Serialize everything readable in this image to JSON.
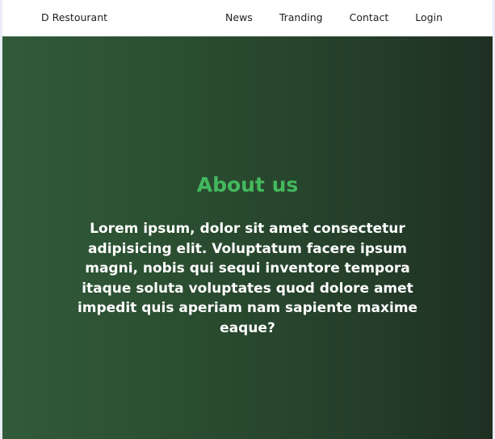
{
  "nav": {
    "brand": "D Restourant",
    "links": [
      "News",
      "Tranding",
      "Contact",
      "Login"
    ]
  },
  "hero": {
    "title": "About us",
    "text": "Lorem ipsum, dolor sit amet consectetur adipisicing elit. Voluptatum facere ipsum magni, nobis qui sequi inventore tempora itaque soluta voluptates quod dolore amet impedit quis aperiam nam sapiente maxime eaque?"
  },
  "next_section": {
    "title": ""
  },
  "colors": {
    "accent_green": "#44b85d",
    "hero_left": "#315b3a",
    "hero_right": "#1f3022"
  }
}
